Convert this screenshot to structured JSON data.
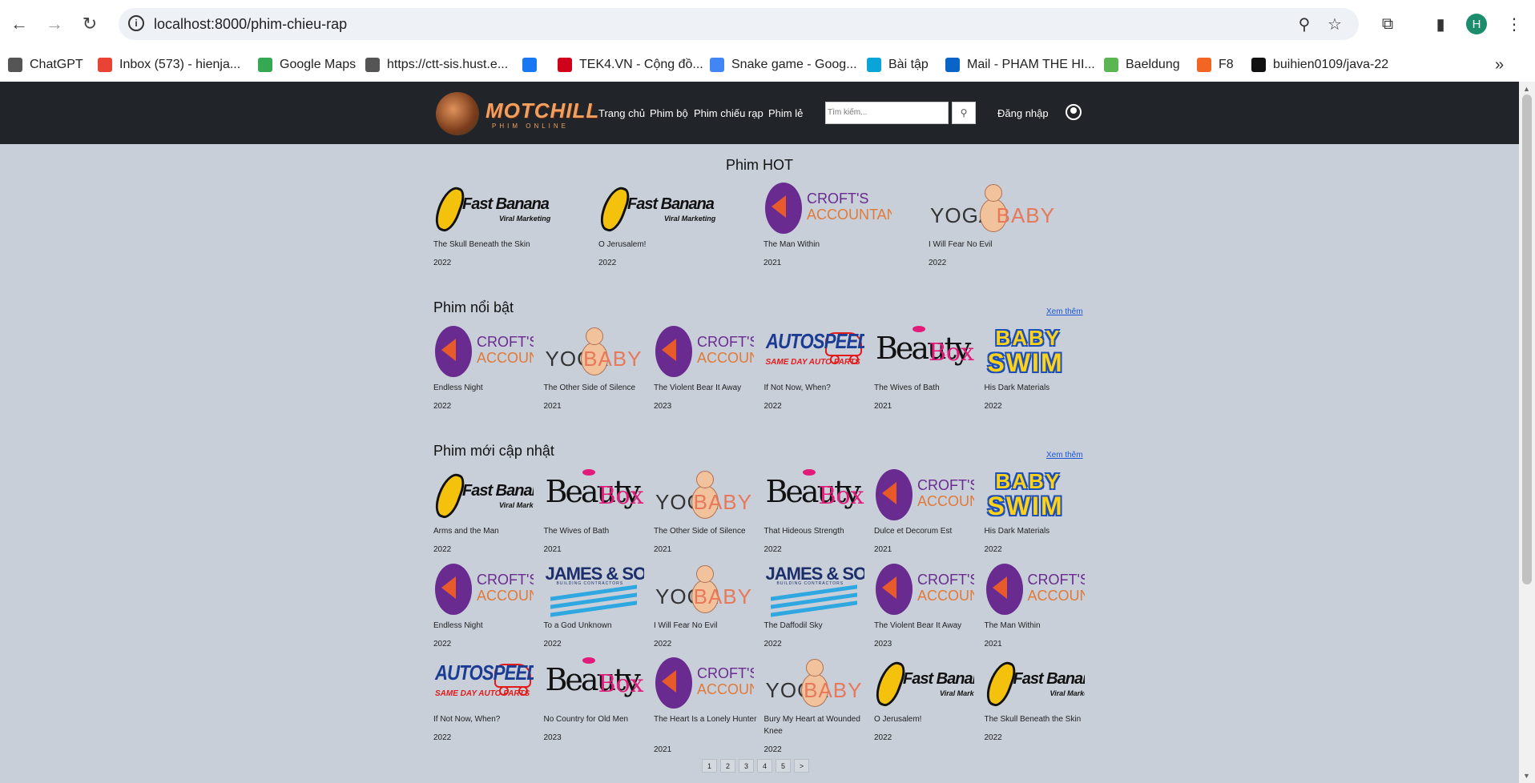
{
  "browser": {
    "url": "localhost:8000/phim-chieu-rap",
    "profile_initial": "H",
    "bookmarks": [
      {
        "label": "ChatGPT",
        "icon": "chatgpt-icon",
        "color": "#555555"
      },
      {
        "label": "Inbox (573) - hienja...",
        "icon": "gmail-icon",
        "color": "#ea4335"
      },
      {
        "label": "Google Maps",
        "icon": "maps-icon",
        "color": "#34a853"
      },
      {
        "label": "https://ctt-sis.hust.e...",
        "icon": "globe-icon",
        "color": "#555555"
      },
      {
        "label": "",
        "icon": "facebook-icon",
        "color": "#1877f2"
      },
      {
        "label": "TEK4.VN - Cộng đồ...",
        "icon": "tek4-icon",
        "color": "#d0021b"
      },
      {
        "label": "Snake game - Goog...",
        "icon": "docs-icon",
        "color": "#4285f4"
      },
      {
        "label": "Bài tập",
        "icon": "trello-icon",
        "color": "#0aa5d8"
      },
      {
        "label": "Mail - PHAM THE HI...",
        "icon": "outlook-icon",
        "color": "#0a64c8"
      },
      {
        "label": "Baeldung",
        "icon": "baeldung-icon",
        "color": "#5ab552"
      },
      {
        "label": "F8",
        "icon": "f8-icon",
        "color": "#f26522"
      },
      {
        "label": "buihien0109/java-22",
        "icon": "github-icon",
        "color": "#111111"
      }
    ]
  },
  "header": {
    "logo_text": "MOTCHILL",
    "logo_sub": "PHIM ONLINE",
    "menu": [
      "Trang chủ",
      "Phim bộ",
      "Phim chiếu rạp",
      "Phim lẻ"
    ],
    "search_placeholder": "Tìm kiếm...",
    "login": "Đăng nhập"
  },
  "hot": {
    "title": "Phim HOT",
    "items": [
      {
        "title": "The Skull Beneath the Skin",
        "year": "2022",
        "logo": "fastbanana"
      },
      {
        "title": "O Jerusalem!",
        "year": "2022",
        "logo": "fastbanana"
      },
      {
        "title": "The Man Within",
        "year": "2021",
        "logo": "crofts"
      },
      {
        "title": "I Will Fear No Evil",
        "year": "2022",
        "logo": "yogababy"
      }
    ]
  },
  "featured": {
    "title": "Phim nổi bật",
    "more": "Xem thêm",
    "items": [
      {
        "title": "Endless Night",
        "year": "2022",
        "logo": "crofts"
      },
      {
        "title": "The Other Side of Silence",
        "year": "2021",
        "logo": "yogababy"
      },
      {
        "title": "The Violent Bear It Away",
        "year": "2023",
        "logo": "crofts"
      },
      {
        "title": "If Not Now, When?",
        "year": "2022",
        "logo": "autospeed"
      },
      {
        "title": "The Wives of Bath",
        "year": "2021",
        "logo": "beautybox"
      },
      {
        "title": "His Dark Materials",
        "year": "2022",
        "logo": "babyswim"
      }
    ]
  },
  "latest": {
    "title": "Phim mới cập nhật",
    "more": "Xem thêm",
    "items": [
      {
        "title": "Arms and the Man",
        "year": "2022",
        "logo": "fastbanana"
      },
      {
        "title": "The Wives of Bath",
        "year": "2021",
        "logo": "beautybox"
      },
      {
        "title": "The Other Side of Silence",
        "year": "2021",
        "logo": "yogababy"
      },
      {
        "title": "That Hideous Strength",
        "year": "2022",
        "logo": "beautybox"
      },
      {
        "title": "Dulce et Decorum Est",
        "year": "2021",
        "logo": "crofts"
      },
      {
        "title": "His Dark Materials",
        "year": "2022",
        "logo": "babyswim"
      },
      {
        "title": "Endless Night",
        "year": "2022",
        "logo": "crofts"
      },
      {
        "title": "To a God Unknown",
        "year": "2022",
        "logo": "jamessons"
      },
      {
        "title": "I Will Fear No Evil",
        "year": "2022",
        "logo": "yogababy"
      },
      {
        "title": "The Daffodil Sky",
        "year": "2022",
        "logo": "jamessons"
      },
      {
        "title": "The Violent Bear It Away",
        "year": "2023",
        "logo": "crofts"
      },
      {
        "title": "The Man Within",
        "year": "2021",
        "logo": "crofts"
      },
      {
        "title": "If Not Now, When?",
        "year": "2022",
        "logo": "autospeed"
      },
      {
        "title": "No Country for Old Men",
        "year": "2023",
        "logo": "beautybox"
      },
      {
        "title": "The Heart Is a Lonely Hunter",
        "year": "2021",
        "logo": "crofts"
      },
      {
        "title": "Bury My Heart at Wounded Knee",
        "year": "2022",
        "logo": "yogababy"
      },
      {
        "title": "O Jerusalem!",
        "year": "2022",
        "logo": "fastbanana"
      },
      {
        "title": "The Skull Beneath the Skin",
        "year": "2022",
        "logo": "fastbanana"
      }
    ]
  },
  "logo_texts": {
    "fastbanana": [
      "Fast Banana",
      "Viral Marketing"
    ],
    "crofts": [
      "CROFT'S",
      "ACCOUNTANTS"
    ],
    "yogababy": [
      "YOGA",
      "BABY"
    ],
    "beautybox": [
      "Beauty",
      "Box"
    ],
    "autospeed": [
      "AUTOSPEED",
      "SAME DAY AUTO PARTS"
    ],
    "babyswim": [
      "BABY",
      "SWIM"
    ],
    "jamessons": [
      "JAMES & SONS",
      "BUILDING CONTRACTORS"
    ]
  },
  "pagination": [
    "1",
    "2",
    "3",
    "4",
    "5",
    ">"
  ]
}
